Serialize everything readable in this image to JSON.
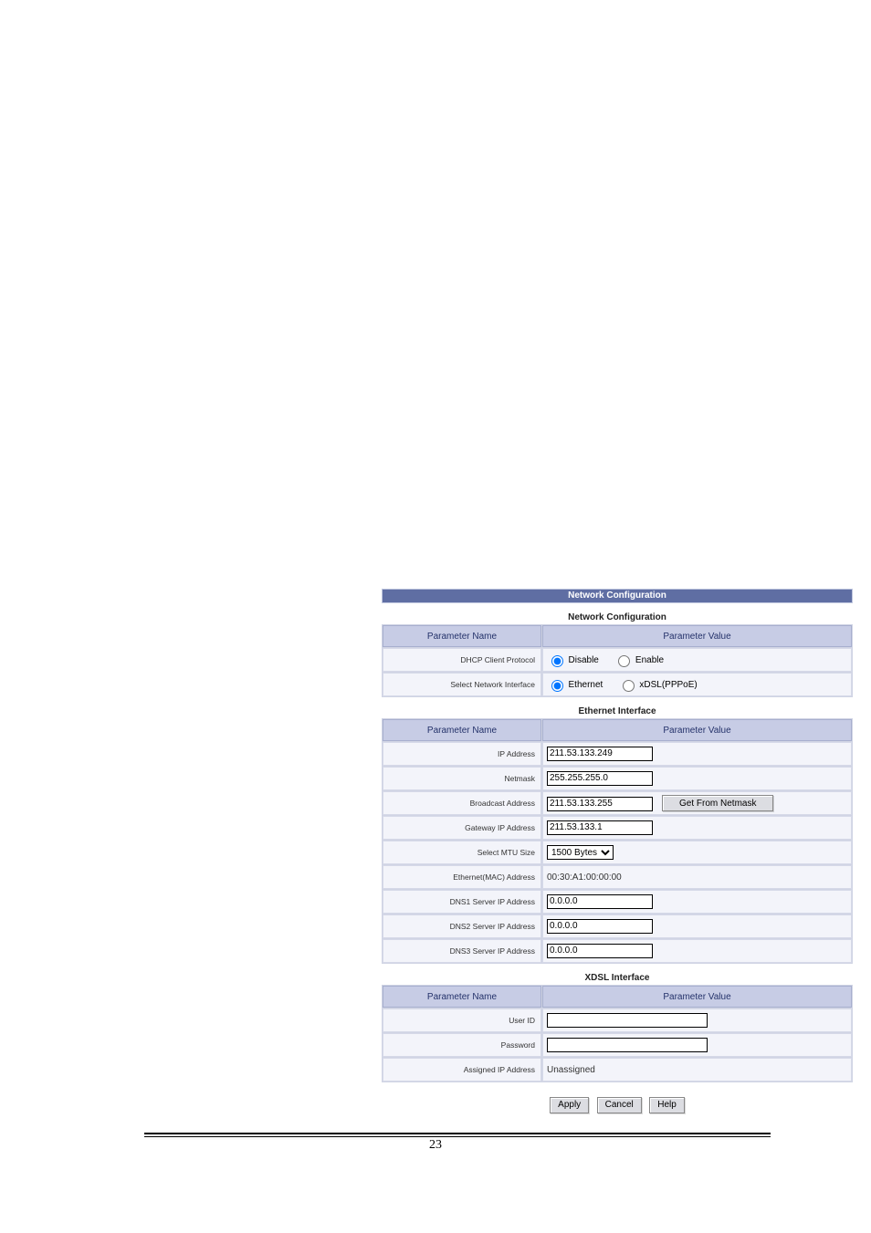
{
  "page_number": "23",
  "banner_title": "Network Configuration",
  "network_config": {
    "title": "Network Configuration",
    "header_name": "Parameter Name",
    "header_value": "Parameter Value",
    "rows": {
      "dhcp_label": "DHCP Client Protocol",
      "dhcp_disable": "Disable",
      "dhcp_enable": "Enable",
      "select_if_label": "Select Network Interface",
      "select_if_eth": "Ethernet",
      "select_if_xdsl": "xDSL(PPPoE)"
    }
  },
  "ethernet": {
    "title": "Ethernet Interface",
    "header_name": "Parameter Name",
    "header_value": "Parameter Value",
    "ip_label": "IP Address",
    "ip_value": "211.53.133.249",
    "netmask_label": "Netmask",
    "netmask_value": "255.255.255.0",
    "broadcast_label": "Broadcast Address",
    "broadcast_value": "211.53.133.255",
    "get_from_netmask_btn": "Get From Netmask",
    "gateway_label": "Gateway IP Address",
    "gateway_value": "211.53.133.1",
    "mtu_label": "Select MTU Size",
    "mtu_value": "1500 Bytes",
    "mac_label": "Ethernet(MAC) Address",
    "mac_value": "00:30:A1:00:00:00",
    "dns1_label": "DNS1 Server IP Address",
    "dns1_value": "0.0.0.0",
    "dns2_label": "DNS2 Server IP Address",
    "dns2_value": "0.0.0.0",
    "dns3_label": "DNS3 Server IP Address",
    "dns3_value": "0.0.0.0"
  },
  "xdsl": {
    "title": "XDSL Interface",
    "header_name": "Parameter Name",
    "header_value": "Parameter Value",
    "user_id_label": "User ID",
    "user_id_value": "",
    "password_label": "Password",
    "password_value": "",
    "assigned_ip_label": "Assigned IP Address",
    "assigned_ip_value": "Unassigned"
  },
  "buttons": {
    "apply": "Apply",
    "cancel": "Cancel",
    "help": "Help"
  }
}
